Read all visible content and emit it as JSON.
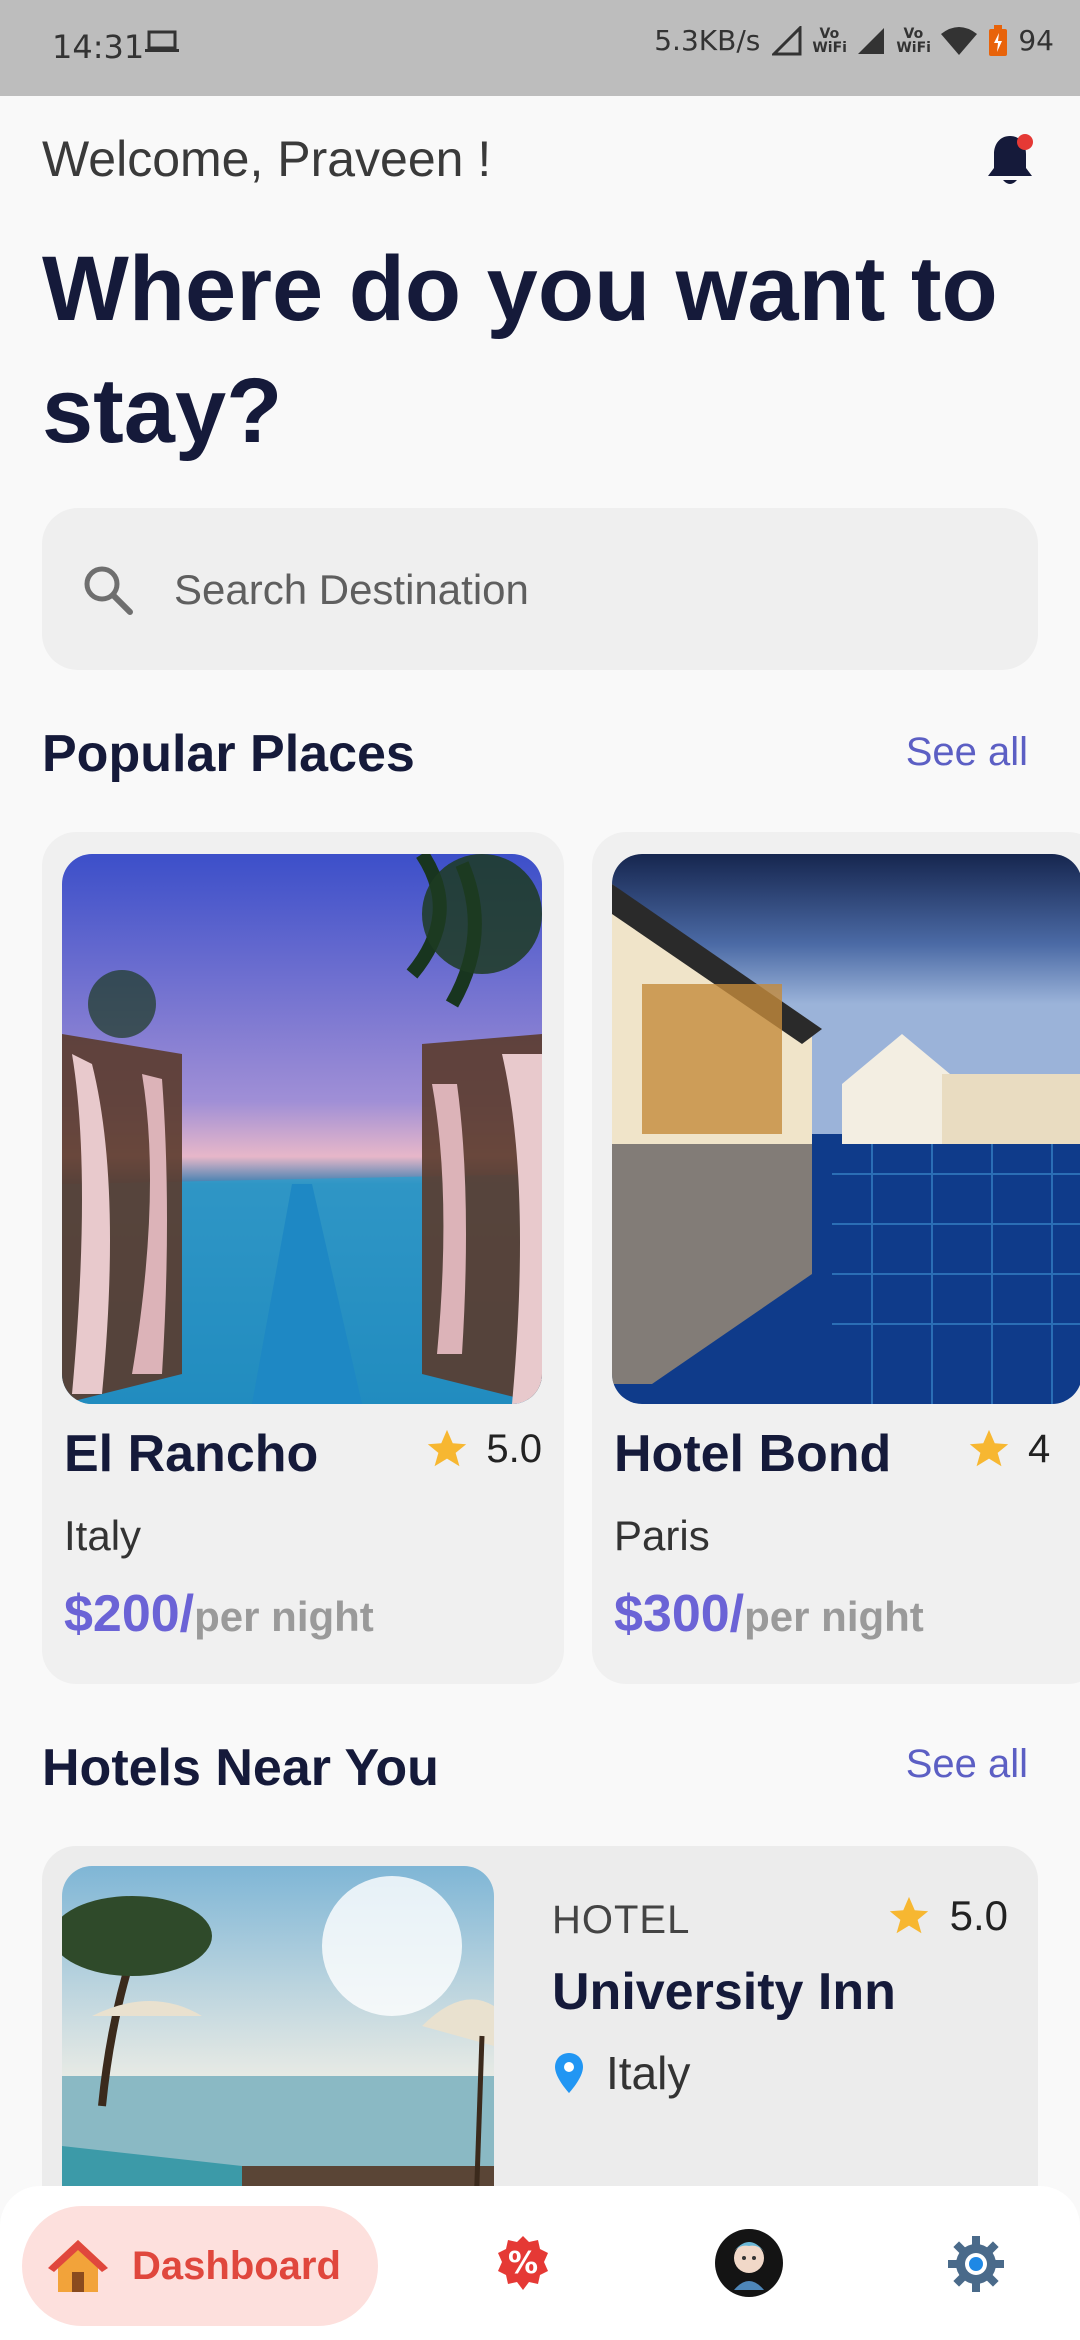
{
  "status_bar": {
    "time": "14:31",
    "speed": "5.3KB/s",
    "vowifi_1": "Vo WiFi",
    "vowifi_2": "Vo WiFi",
    "battery": "94"
  },
  "header": {
    "welcome": "Welcome, Praveen !",
    "headline": "Where do you want to stay?",
    "notification_icon": "bell-icon"
  },
  "search": {
    "placeholder": "Search Destination"
  },
  "popular": {
    "title": "Popular Places",
    "see_all": "See all",
    "items": [
      {
        "name": "El Rancho",
        "rating": "5.0",
        "location": "Italy",
        "price": "$200/",
        "unit": "per night"
      },
      {
        "name": "Hotel Bond",
        "rating": "4",
        "location": "Paris",
        "price": "$300/",
        "unit": "per night"
      }
    ]
  },
  "nearby": {
    "title": "Hotels Near You",
    "see_all": "See all",
    "items": [
      {
        "type": "HOTEL",
        "rating": "5.0",
        "name": "University Inn",
        "location": "Italy"
      }
    ]
  },
  "nav": {
    "dashboard_label": "Dashboard",
    "items": [
      "home-icon",
      "discount-icon",
      "profile-avatar",
      "settings-icon"
    ]
  },
  "colors": {
    "accent": "#5c5fc4",
    "price": "#6b63d6",
    "heading": "#151a3a",
    "star": "#f7b731",
    "nav_active": "#e0473d"
  }
}
